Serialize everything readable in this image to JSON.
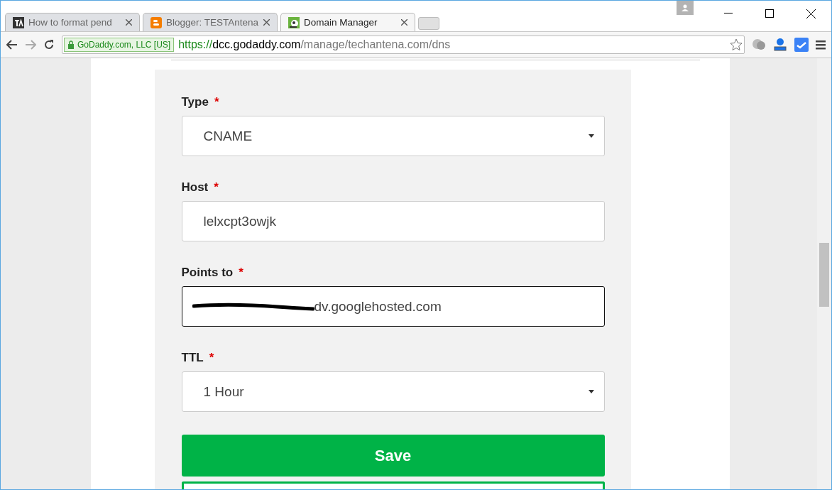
{
  "tabs": [
    {
      "title": "How to format pend",
      "selected": false
    },
    {
      "title": "Blogger: TESTAntena",
      "selected": false
    },
    {
      "title": "Domain Manager",
      "selected": true
    }
  ],
  "address_bar": {
    "security_label": "GoDaddy.com, LLC [US]",
    "scheme": "https://",
    "host": "dcc.godaddy.com",
    "path": "/manage/techantena.com/dns"
  },
  "form": {
    "fields": [
      {
        "kind": "select",
        "label": "Type",
        "required_mark": "*",
        "value": "CNAME"
      },
      {
        "kind": "text",
        "label": "Host",
        "required_mark": "*",
        "value": "lelxcpt3owjk",
        "focused": false
      },
      {
        "kind": "redacted",
        "label": "Points to",
        "required_mark": "*",
        "value": "dv.googlehosted.com",
        "focused": true
      },
      {
        "kind": "select",
        "label": "TTL",
        "required_mark": "*",
        "value": "1 Hour"
      }
    ],
    "save_button": "Save"
  }
}
